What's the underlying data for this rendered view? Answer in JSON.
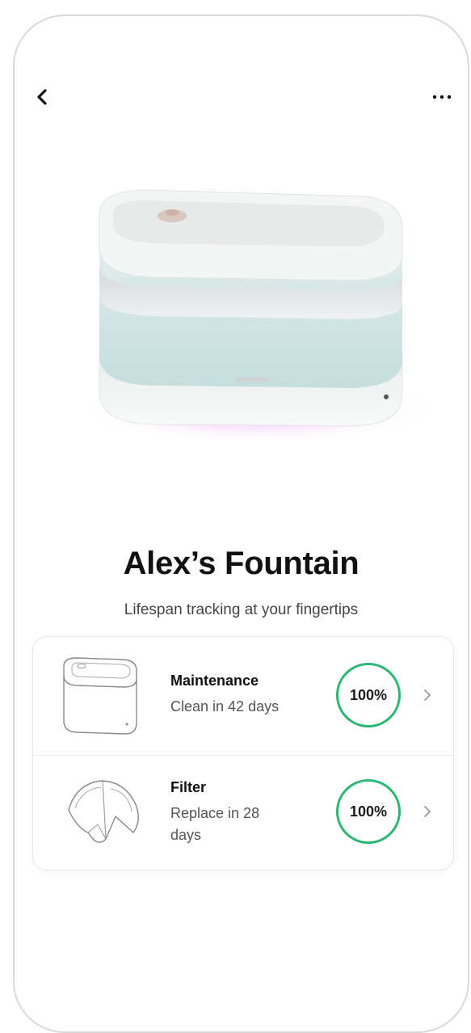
{
  "header": {
    "back_icon": "chevron-left-icon",
    "more_icon": "more-horizontal-icon"
  },
  "device": {
    "name": "Alex’s Fountain",
    "tagline": "Lifespan tracking at your fingertips",
    "glow_color": "#e37bff"
  },
  "items": [
    {
      "title": "Maintenance",
      "subtitle": "Clean in 42 days",
      "percent_label": "100%",
      "percent": 100,
      "icon": "fountain-outline-icon"
    },
    {
      "title": "Filter",
      "subtitle": "Replace in 28 days",
      "percent_label": "100%",
      "percent": 100,
      "icon": "filter-outline-icon"
    }
  ],
  "colors": {
    "accent_ring": "#2bb673",
    "text_primary": "#111111",
    "text_secondary": "#555555"
  }
}
